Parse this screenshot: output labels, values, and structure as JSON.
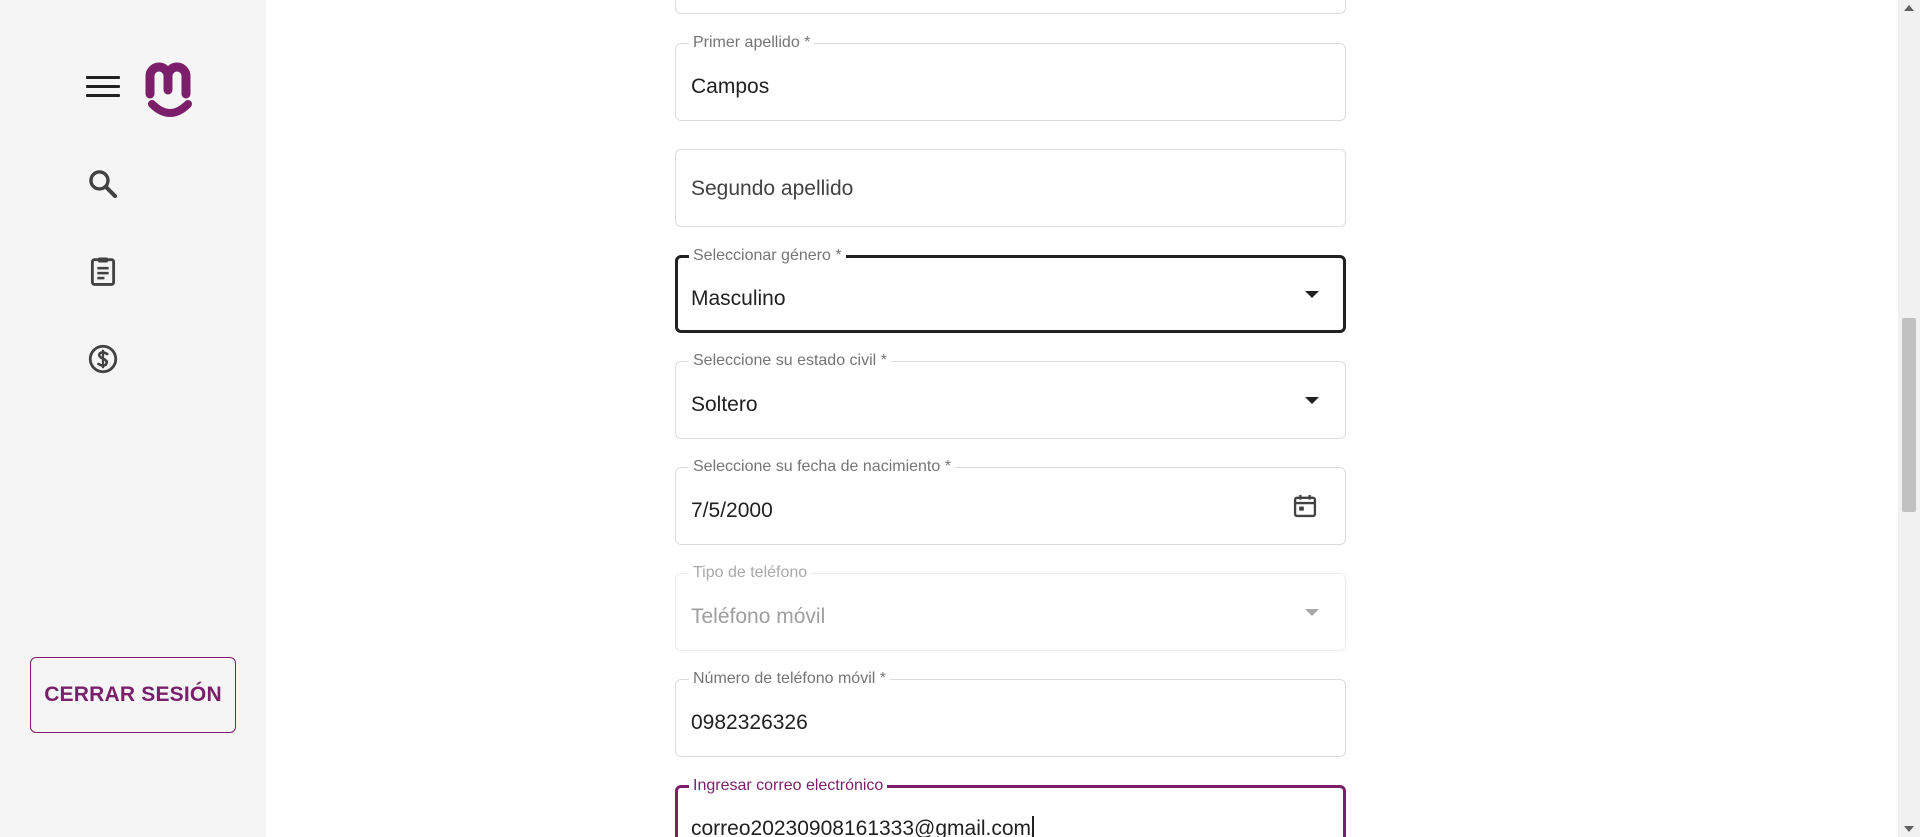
{
  "sidebar": {
    "menu_icon": "menu-icon",
    "logo_icon": "brand-logo",
    "nav": [
      {
        "icon": "search-icon"
      },
      {
        "icon": "clipboard-icon"
      },
      {
        "icon": "dollar-icon"
      }
    ],
    "logout_label": "CERRAR SESIÓN"
  },
  "form": {
    "primer_apellido": {
      "label": "Primer apellido *",
      "value": "Campos"
    },
    "segundo_apellido": {
      "placeholder": "Segundo apellido"
    },
    "genero": {
      "label": "Seleccionar género *",
      "value": "Masculino"
    },
    "estado_civil": {
      "label": "Seleccione su estado civil *",
      "value": "Soltero"
    },
    "fecha_nacimiento": {
      "label": "Seleccione su fecha de nacimiento *",
      "value": "7/5/2000"
    },
    "tipo_telefono": {
      "label": "Tipo de teléfono",
      "value": "Teléfono móvil"
    },
    "telefono_movil": {
      "label": "Número de teléfono móvil *",
      "value": "0982326326"
    },
    "correo": {
      "label": "Ingresar correo electrónico",
      "value": "correo20230908161333@gmail.com"
    }
  },
  "colors": {
    "accent": "#7b1f6a",
    "sidebar_bg": "#f5f5f5",
    "text": "#212121"
  }
}
